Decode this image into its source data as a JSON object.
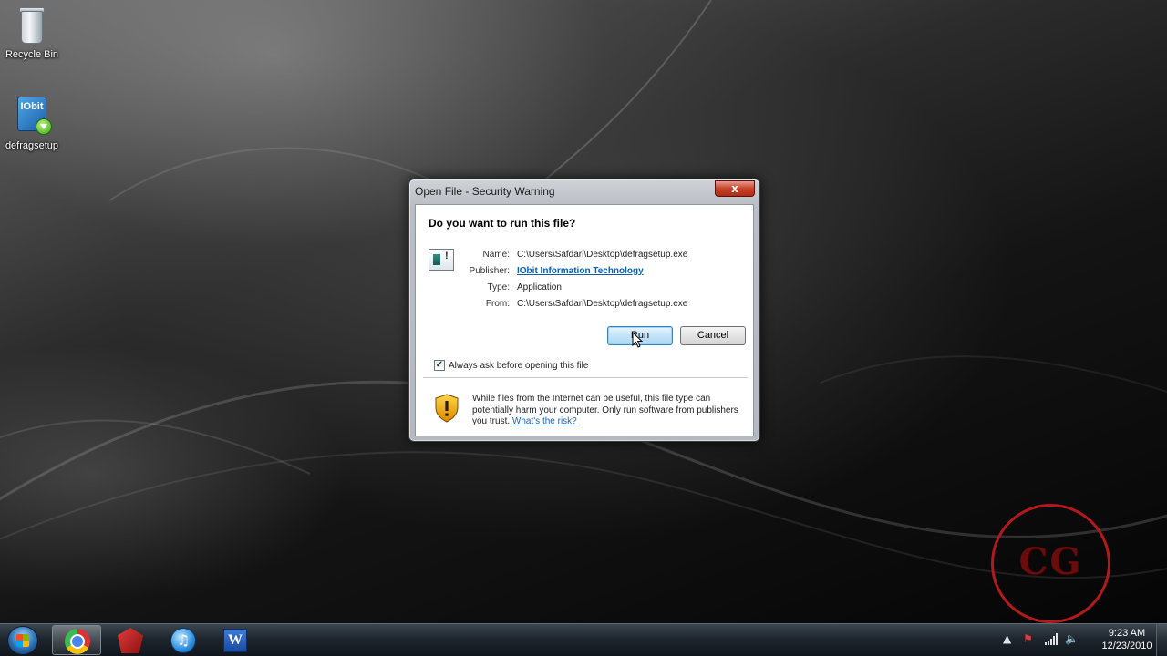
{
  "desktop": {
    "icons": [
      {
        "label": "Recycle Bin",
        "icon": "recycle-bin-icon"
      },
      {
        "label": "defragsetup",
        "icon": "iobit-installer-icon",
        "badge": "IObit"
      }
    ]
  },
  "dialog": {
    "title": "Open File - Security Warning",
    "close_glyph": "x",
    "question": "Do you want to run this file?",
    "fields": [
      {
        "label": "Name:",
        "value": "C:\\Users\\Safdari\\Desktop\\defragsetup.exe"
      },
      {
        "label": "Publisher:",
        "value": "IObit Information Technology"
      },
      {
        "label": "Type:",
        "value": "Application"
      },
      {
        "label": "From:",
        "value": "C:\\Users\\Safdari\\Desktop\\defragsetup.exe"
      }
    ],
    "run_label": "Run",
    "cancel_label": "Cancel",
    "checkbox_label": "Always ask before opening this file",
    "checkbox_checked": true,
    "warning_text": "While files from the Internet can be useful, this file type can potentially harm your computer. Only run software from publishers you trust.",
    "risk_link": "What's the risk?"
  },
  "watermark": {
    "text": "CG",
    "color": "#b3191c"
  },
  "taskbar": {
    "pinned": [
      {
        "name": "chrome-icon",
        "active": true
      },
      {
        "name": "red-app-icon",
        "active": false
      },
      {
        "name": "itunes-icon",
        "active": false,
        "glyph": "♫"
      },
      {
        "name": "word-icon",
        "active": false,
        "glyph": "W"
      }
    ],
    "tray": {
      "time": "9:23 AM",
      "date": "12/23/2010",
      "icons": [
        "show-hidden-icons-icon",
        "action-center-flag-icon",
        "network-signal-icon",
        "volume-icon"
      ]
    }
  },
  "colors": {
    "link": "#0a5fb0",
    "close_button": "#c7422a",
    "run_button_border": "#3c7fb1"
  }
}
